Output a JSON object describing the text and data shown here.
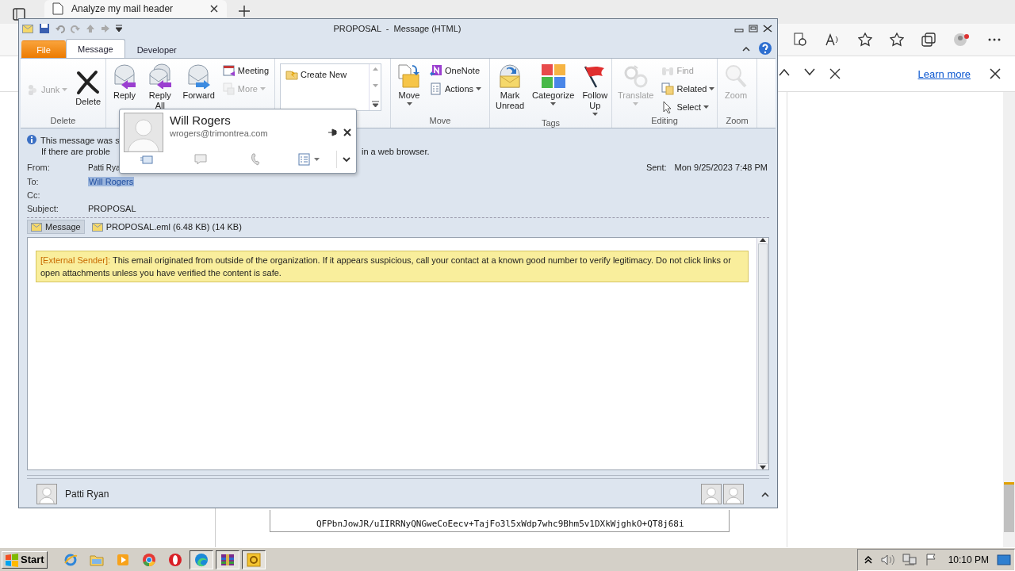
{
  "browser": {
    "tab": {
      "title": "Analyze my mail header"
    },
    "find_bar": {
      "link": "Learn more"
    },
    "textarea_lines": [
      "QFPbnJowJR/uIIRRNyQNGweCoEecv+TajFo3l5xWdp7whc9Bhm5v1DXkWjghkO+QT8j68i"
    ]
  },
  "outlook": {
    "title": "PROPOSAL  -  Message (HTML)",
    "tabs": [
      {
        "label": "File",
        "kind": "backstage",
        "selected": false
      },
      {
        "label": "Message",
        "kind": "tab",
        "selected": true
      },
      {
        "label": "Developer",
        "kind": "tab",
        "selected": false
      }
    ],
    "ribbon": [
      {
        "label": "Delete",
        "items": [
          {
            "kind": "junk",
            "label": "Junk",
            "disabled": true,
            "menu": true
          },
          {
            "kind": "delete",
            "label": "Delete",
            "disabled": false,
            "menu": false
          }
        ]
      },
      {
        "items": [
          {
            "kind": "reply",
            "label": "Reply",
            "disabled": false,
            "menu": false
          },
          {
            "kind": "reply-all",
            "label": "Reply All",
            "disabled": false,
            "menu": false
          },
          {
            "kind": "forward",
            "label": "Forward",
            "disabled": false,
            "menu": false
          },
          {
            "kind": "meeting",
            "label": "Meeting",
            "disabled": false,
            "menu": false
          },
          {
            "kind": "more",
            "label": "More",
            "disabled": true,
            "menu": true
          }
        ]
      },
      {
        "items": [
          {
            "kind": "quick-step",
            "label": "Create New"
          }
        ]
      },
      {
        "label": "Move",
        "items": [
          {
            "kind": "move",
            "label": "Move",
            "disabled": false,
            "menu": true
          },
          {
            "kind": "onenote",
            "label": "OneNote",
            "disabled": false,
            "menu": false
          },
          {
            "kind": "actions",
            "label": "Actions",
            "disabled": false,
            "menu": true
          }
        ]
      },
      {
        "label": "Tags",
        "items": [
          {
            "kind": "mark-unread",
            "label": "Mark Unread",
            "disabled": false,
            "menu": false
          },
          {
            "kind": "categorize",
            "label": "Categorize",
            "disabled": false,
            "menu": true
          },
          {
            "kind": "follow-up",
            "label": "Follow Up",
            "disabled": false,
            "menu": true
          }
        ]
      },
      {
        "label": "Editing",
        "items": [
          {
            "kind": "translate",
            "label": "Translate",
            "disabled": true,
            "menu": true
          },
          {
            "kind": "find",
            "label": "Find",
            "disabled": true,
            "menu": false
          },
          {
            "kind": "related",
            "label": "Related",
            "disabled": false,
            "menu": true
          },
          {
            "kind": "select",
            "label": "Select",
            "disabled": false,
            "menu": true
          }
        ]
      },
      {
        "label": "Zoom",
        "items": [
          {
            "kind": "zoom",
            "label": "Zoom",
            "disabled": true,
            "menu": false
          }
        ]
      }
    ],
    "info_bar": {
      "line_1": "This message was s",
      "line_2_start": "If there are proble",
      "line_2_end": "in a web browser."
    },
    "header": {
      "from": {
        "label": "From:",
        "value": "Patti Rya"
      },
      "to": {
        "label": "To:",
        "value": "Will Rogers",
        "highlighted": true
      },
      "cc": {
        "label": "Cc:"
      },
      "subject": {
        "label": "Subject:",
        "value": "PROPOSAL"
      },
      "sent": {
        "label": "Sent:",
        "value": "Mon 9/25/2023 7:48 PM"
      }
    },
    "attachments": [
      {
        "label": "Message",
        "selected": true
      },
      {
        "label": "PROPOSAL.eml (6.48 KB) (14 KB)",
        "selected": false
      }
    ],
    "banner": {
      "tag": "[External Sender]:",
      "text": "This email originated from outside of the organization. If it appears suspicious, call your contact at a known good number to verify legitimacy. Do not click links or open attachments unless you have verified the content is safe."
    },
    "people_pane": {
      "name": "Patti Ryan"
    },
    "contact_card": {
      "name": "Will Rogers",
      "email": "wrogers@trimontrea.com"
    }
  },
  "taskbar": {
    "start": "Start",
    "apps": [
      {
        "kind": "ie",
        "open": false
      },
      {
        "kind": "folder",
        "open": false
      },
      {
        "kind": "media",
        "open": false
      },
      {
        "kind": "chrome",
        "open": false
      },
      {
        "kind": "opera",
        "open": false
      },
      {
        "kind": "edge",
        "open": true
      },
      {
        "kind": "archive",
        "open": true
      },
      {
        "kind": "outlook",
        "open": true
      }
    ],
    "clock": "10:10 PM"
  }
}
